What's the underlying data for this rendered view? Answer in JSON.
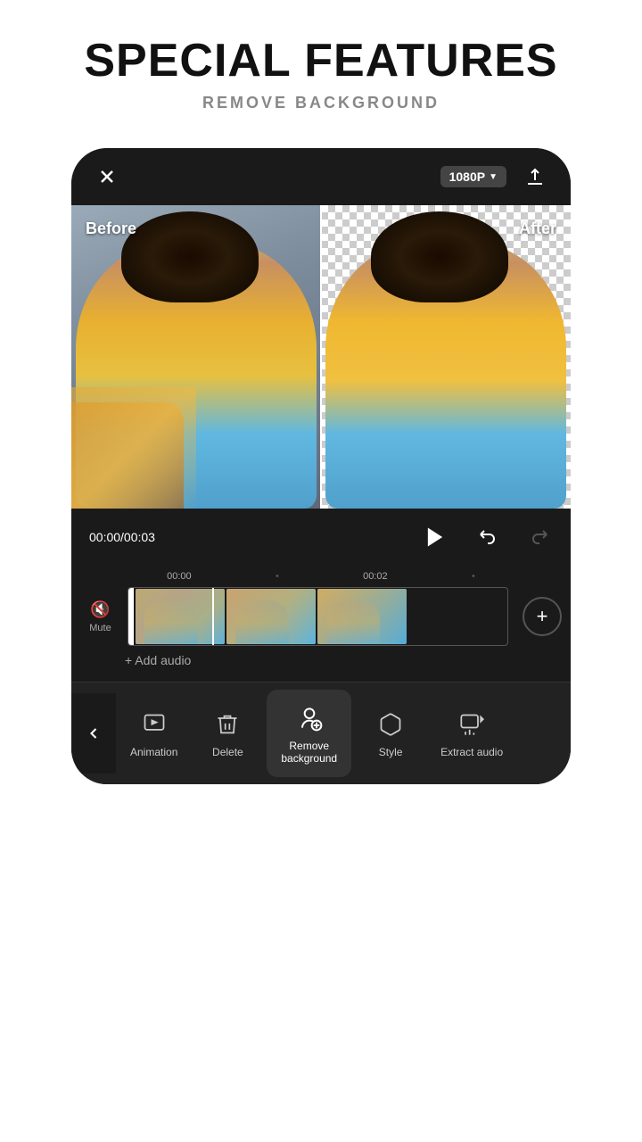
{
  "header": {
    "title": "SPECIAL FEATURES",
    "subtitle": "REMOVE BACKGROUND"
  },
  "topbar": {
    "quality_label": "1080P",
    "quality_arrow": "▼"
  },
  "preview": {
    "label_before": "Before",
    "label_after": "After"
  },
  "controls": {
    "time_current": "00:00",
    "time_total": "00:03",
    "time_display": "00:00/00:03"
  },
  "timeline": {
    "ruler_times": [
      "00:00",
      "00:02"
    ],
    "mute_label": "Mute",
    "add_audio_label": "+ Add audio"
  },
  "toolbar": {
    "back_arrow": "‹",
    "items": [
      {
        "id": "animation",
        "label": "Animation",
        "icon": "animation"
      },
      {
        "id": "delete",
        "label": "Delete",
        "icon": "delete"
      },
      {
        "id": "remove-background",
        "label": "Remove\nbackground",
        "icon": "remove-bg",
        "active": true
      },
      {
        "id": "style",
        "label": "Style",
        "icon": "style"
      },
      {
        "id": "extract-audio",
        "label": "Extract audio",
        "icon": "extract-audio"
      }
    ]
  }
}
